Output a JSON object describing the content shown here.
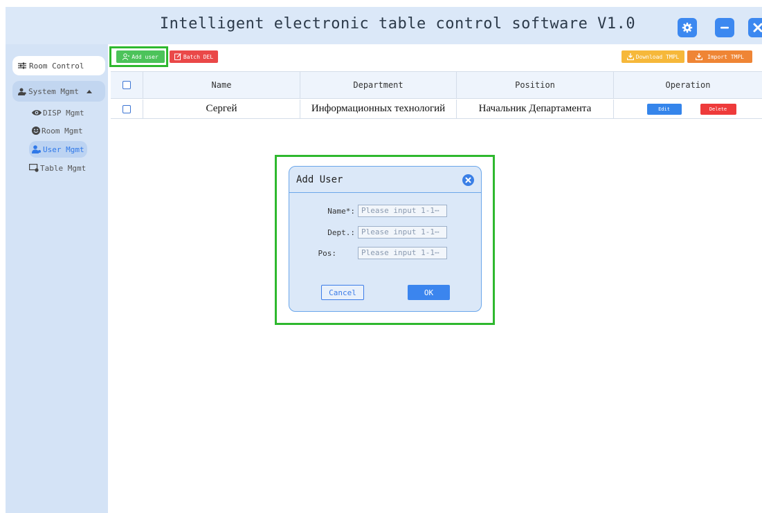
{
  "window": {
    "title": "Intelligent electronic table control software V1.0",
    "icons": {
      "settings": "gear-icon",
      "minimize": "minimize-icon",
      "close": "close-icon"
    }
  },
  "sidebar": {
    "room_control": "Room Control",
    "system_mgmt": "System Mgmt",
    "items": [
      {
        "label": "DISP Mgmt",
        "icon": "eye-icon"
      },
      {
        "label": "Room Mgmt",
        "icon": "smiley-icon"
      },
      {
        "label": "User Mgmt",
        "icon": "user-icon",
        "active": true
      },
      {
        "label": "Table Mgmt",
        "icon": "table-icon"
      }
    ]
  },
  "toolbar": {
    "add_user": "Add user",
    "batch_del": "Batch DEL",
    "download_tmpl": "Download TMPL",
    "import_tmpl": "Import TMPL"
  },
  "table": {
    "headers": [
      "Name",
      "Department",
      "Position",
      "Operation"
    ],
    "rows": [
      {
        "name": "Сергей",
        "department": "Информационных технологий",
        "position": "Начальник Департамента",
        "edit": "Edit",
        "delete": "Delete"
      }
    ]
  },
  "dialog": {
    "title": "Add User",
    "fields": [
      {
        "label": "Name*:",
        "placeholder": "Please input 1-1⋯"
      },
      {
        "label": "Dept.:",
        "placeholder": "Please input 1-1⋯"
      },
      {
        "label": "Pos:",
        "placeholder": "Please input 1-1⋯"
      }
    ],
    "cancel": "Cancel",
    "ok": "OK"
  },
  "colors": {
    "accent": "#3c88f0",
    "add_green": "#4cc35a",
    "delete_red": "#ea4848",
    "download_yellow": "#f6b83a",
    "import_orange": "#ef8535",
    "highlight_green": "#2eb82e"
  }
}
